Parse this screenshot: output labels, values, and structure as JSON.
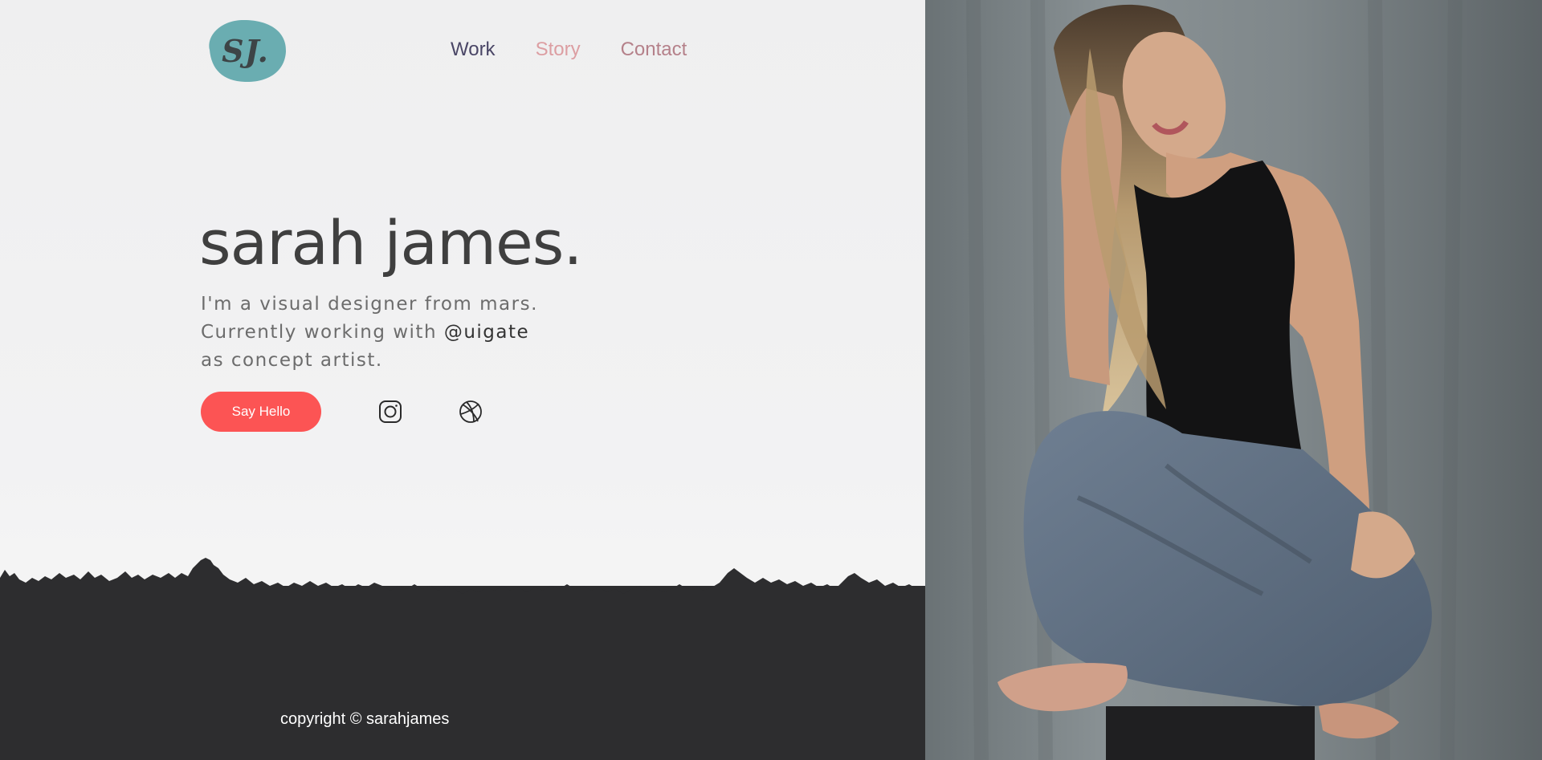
{
  "brand": {
    "logo_text": "SJ.",
    "logo_color": "#6aadb1"
  },
  "nav": {
    "work": "Work",
    "story": "Story",
    "contact": "Contact"
  },
  "hero": {
    "title": "sarah james.",
    "line1": "I'm a visual designer from mars.",
    "line2_prefix": "Currently working with ",
    "handle": "@uigate",
    "line3": "as concept artist.",
    "cta": "Say Hello"
  },
  "social": {
    "instagram": "instagram-icon",
    "dribbble": "dribbble-icon"
  },
  "footer": {
    "copyright": "copyright © sarahjames"
  },
  "colors": {
    "accent": "#fc5454",
    "footer_bg": "#2d2d2f",
    "text_dark": "#3f3f3f"
  }
}
